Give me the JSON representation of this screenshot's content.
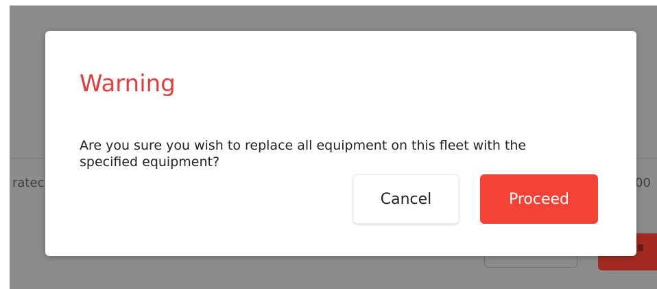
{
  "background": {
    "left_fragment": "ratec",
    "right_fragment": "00"
  },
  "modal": {
    "title": "Warning",
    "message": "Are you sure you wish to replace all equipment on this fleet with the specified equipment?",
    "cancel_label": "Cancel",
    "proceed_label": "Proceed"
  },
  "colors": {
    "title": "#e23c3c",
    "proceed_bg": "#f44336",
    "backdrop": "#8c8c8c"
  }
}
